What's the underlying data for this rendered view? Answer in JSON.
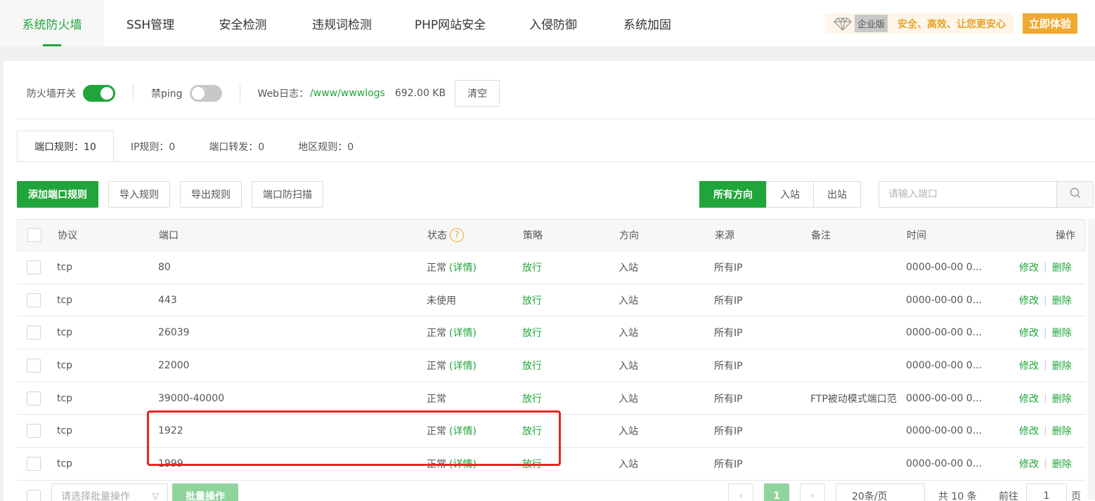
{
  "nav": {
    "tabs": [
      {
        "label": "系统防火墙",
        "active": true
      },
      {
        "label": "SSH管理",
        "active": false
      },
      {
        "label": "安全检测",
        "active": false
      },
      {
        "label": "违规词检测",
        "active": false
      },
      {
        "label": "PHP网站安全",
        "active": false
      },
      {
        "label": "入侵防御",
        "active": false
      },
      {
        "label": "系统加固",
        "active": false
      }
    ],
    "edition_badge": "企业版",
    "promo_text": "安全、高效、让您更安心",
    "try_button": "立即体验"
  },
  "controls": {
    "firewall_label": "防火墙开关",
    "firewall_on": true,
    "ping_label": "禁ping",
    "ping_on": false,
    "weblog_label": "Web日志：",
    "weblog_path": "/www/wwwlogs",
    "weblog_size": "692.00 KB",
    "clear_button": "清空"
  },
  "rule_tabs": [
    {
      "label": "端口规则：10",
      "active": true
    },
    {
      "label": "IP规则：0",
      "active": false
    },
    {
      "label": "端口转发：0",
      "active": false
    },
    {
      "label": "地区规则：0",
      "active": false
    }
  ],
  "toolbar": {
    "add": "添加端口规则",
    "import": "导入规则",
    "export": "导出规则",
    "scan": "端口防扫描"
  },
  "direction": {
    "all": "所有方向",
    "in": "入站",
    "out": "出站"
  },
  "search": {
    "placeholder": "请输入端口"
  },
  "table": {
    "headers": {
      "protocol": "协议",
      "port": "端口",
      "status": "状态",
      "strategy": "策略",
      "direction": "方向",
      "source": "来源",
      "remark": "备注",
      "time": "时间",
      "actions": "操作"
    },
    "rows": [
      {
        "protocol": "tcp",
        "port": "80",
        "status": "正常",
        "detail": "(详情)",
        "strategy": "放行",
        "direction": "入站",
        "source": "所有IP",
        "remark": "",
        "time": "0000-00-00 0...",
        "edit": "修改",
        "delete": "删除"
      },
      {
        "protocol": "tcp",
        "port": "443",
        "status": "未使用",
        "detail": "",
        "strategy": "放行",
        "direction": "入站",
        "source": "所有IP",
        "remark": "",
        "time": "0000-00-00 0...",
        "edit": "修改",
        "delete": "删除"
      },
      {
        "protocol": "tcp",
        "port": "26039",
        "status": "正常",
        "detail": "(详情)",
        "strategy": "放行",
        "direction": "入站",
        "source": "所有IP",
        "remark": "",
        "time": "0000-00-00 0...",
        "edit": "修改",
        "delete": "删除"
      },
      {
        "protocol": "tcp",
        "port": "22000",
        "status": "正常",
        "detail": "(详情)",
        "strategy": "放行",
        "direction": "入站",
        "source": "所有IP",
        "remark": "",
        "time": "0000-00-00 0...",
        "edit": "修改",
        "delete": "删除"
      },
      {
        "protocol": "tcp",
        "port": "39000-40000",
        "status": "正常",
        "detail": "",
        "strategy": "放行",
        "direction": "入站",
        "source": "所有IP",
        "remark": "FTP被动模式端口范",
        "time": "0000-00-00 0...",
        "edit": "修改",
        "delete": "删除"
      },
      {
        "protocol": "tcp",
        "port": "1922",
        "status": "正常",
        "detail": "(详情)",
        "strategy": "放行",
        "direction": "入站",
        "source": "所有IP",
        "remark": "",
        "time": "0000-00-00 0...",
        "edit": "修改",
        "delete": "删除"
      },
      {
        "protocol": "tcp",
        "port": "1999",
        "status": "正常",
        "detail": "(详情)",
        "strategy": "放行",
        "direction": "入站",
        "source": "所有IP",
        "remark": "",
        "time": "0000-00-00 0...",
        "edit": "修改",
        "delete": "删除"
      }
    ]
  },
  "footer": {
    "batch_select_placeholder": "请选择批量操作",
    "batch_button": "批量操作",
    "current_page": "1",
    "page_size": "20条/页",
    "total": "共 10 条",
    "goto_label": "前往",
    "goto_value": "1",
    "page_suffix": "页"
  }
}
